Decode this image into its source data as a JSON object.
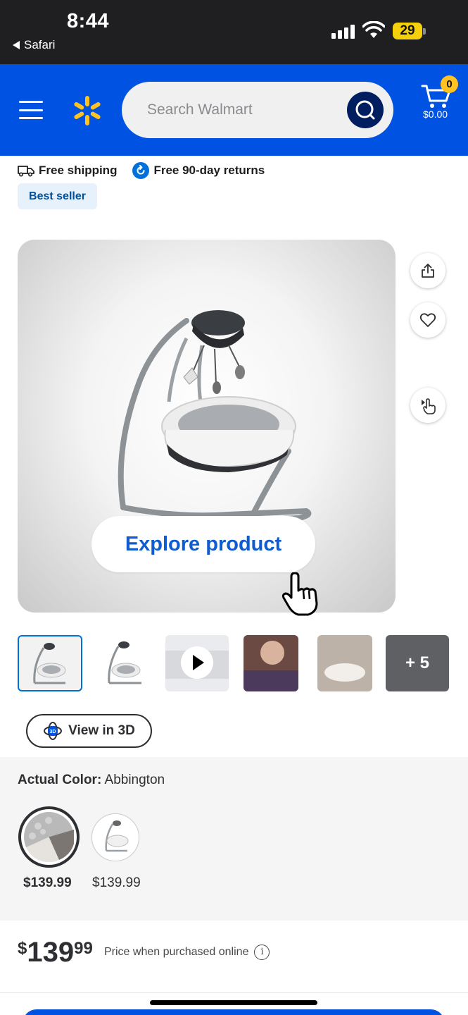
{
  "status_bar": {
    "time": "8:44",
    "back_app": "Safari",
    "battery": "29"
  },
  "header": {
    "search_placeholder": "Search Walmart",
    "cart_count": "0",
    "cart_total": "$0.00",
    "brand_color": "#0053e2",
    "spark_color": "#ffc220"
  },
  "perks": {
    "shipping": "Free shipping",
    "returns": "Free 90-day returns"
  },
  "badge": {
    "label": "Best seller"
  },
  "hero": {
    "explore_label": "Explore product"
  },
  "thumbnails": {
    "more_label": "+ 5"
  },
  "view3d": {
    "label": "View in 3D",
    "badge": "3D"
  },
  "variant": {
    "label": "Actual Color:",
    "value": "Abbington",
    "options": [
      {
        "price": "$139.99",
        "selected": true
      },
      {
        "price": "$139.99",
        "selected": false
      }
    ]
  },
  "price": {
    "currency": "$",
    "whole": "139",
    "cents": "99",
    "note": "Price when purchased online"
  }
}
